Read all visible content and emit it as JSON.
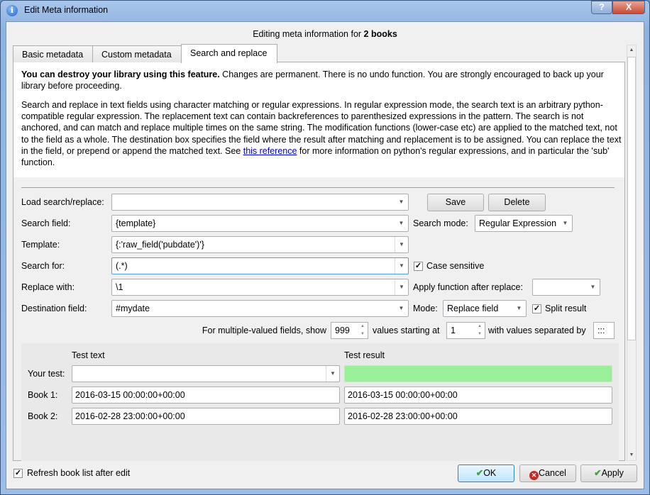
{
  "window": {
    "title": "Edit Meta information",
    "help": "?",
    "close": "X"
  },
  "heading": {
    "prefix": "Editing meta information for ",
    "count": "2 books"
  },
  "tabs": [
    {
      "label": "Basic metadata"
    },
    {
      "label": "Custom metadata"
    },
    {
      "label": "Search and replace"
    }
  ],
  "warning": {
    "bold": "You can destroy your library using this feature.",
    "rest": " Changes are permanent. There is no undo function. You are strongly encouraged to back up your library before proceeding."
  },
  "description": {
    "before": "Search and replace in text fields using character matching or regular expressions. In regular expression mode, the search text is an arbitrary python-compatible regular expression. The replacement text can contain backreferences to parenthesized expressions in the pattern. The search is not anchored, and can match and replace multiple times on the same string. The modification functions (lower-case etc) are applied to the matched text, not to the field as a whole. The destination box specifies the field where the result after matching and replacement is to be assigned. You can replace the text in the field, or prepend or append the matched text. See ",
    "link": "this reference",
    "after": " for more information on python's regular expressions, and in particular the 'sub' function."
  },
  "form": {
    "load_label": "Load search/replace:",
    "load_value": "",
    "save": "Save",
    "delete": "Delete",
    "search_field_label": "Search field:",
    "search_field": "{template}",
    "search_mode_label": "Search mode:",
    "search_mode": "Regular Expression",
    "template_label": "Template:",
    "template": "{:'raw_field('pubdate')'}",
    "search_for_label": "Search for:",
    "search_for": "(.*)",
    "case_sensitive": "Case sensitive",
    "case_sensitive_checked": true,
    "replace_label": "Replace with:",
    "replace": "\\1",
    "apply_function_label": "Apply function after replace:",
    "apply_function": "",
    "dest_label": "Destination field:",
    "dest": "#mydate",
    "mode_label": "Mode:",
    "mode": "Replace field",
    "split_result": "Split result",
    "split_result_checked": true,
    "multi_prefix": "For multiple-valued fields, show",
    "multi_count": "999",
    "multi_mid": "values starting at",
    "multi_start": "1",
    "multi_suffix": "with values separated by",
    "separator": ":::"
  },
  "test": {
    "text_header": "Test text",
    "result_header": "Test result",
    "your_test_label": "Your test:",
    "your_test": "",
    "your_result": "",
    "result_color": "#98f098",
    "books": [
      {
        "label": "Book 1:",
        "text": "2016-03-15 00:00:00+00:00",
        "result": "2016-03-15 00:00:00+00:00"
      },
      {
        "label": "Book 2:",
        "text": "2016-02-28 23:00:00+00:00",
        "result": "2016-02-28 23:00:00+00:00"
      }
    ]
  },
  "footer": {
    "refresh": "Refresh book list after edit",
    "refresh_checked": true,
    "ok": "OK",
    "cancel": "Cancel",
    "apply": "Apply"
  }
}
